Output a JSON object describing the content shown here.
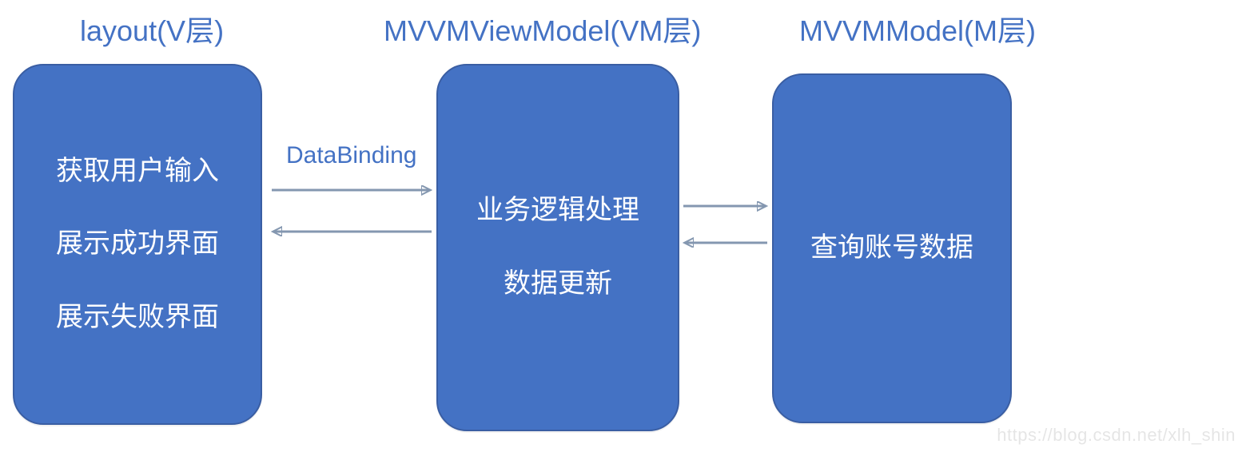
{
  "titles": {
    "view": "layout(V层)",
    "viewmodel": "MVVMViewModel(VM层)",
    "model": "MVVMModel(M层)"
  },
  "boxes": {
    "view": {
      "lines": [
        "获取用户输入",
        "展示成功界面",
        "展示失败界面"
      ]
    },
    "viewmodel": {
      "lines": [
        "业务逻辑处理",
        "数据更新"
      ]
    },
    "model": {
      "lines": [
        "查询账号数据"
      ]
    }
  },
  "connectors": {
    "view_vm_label": "DataBinding"
  },
  "colors": {
    "accent": "#4472c4",
    "box_border": "#3a5ea3",
    "arrow": "#8497b0"
  },
  "watermark": "https://blog.csdn.net/xlh_shin"
}
